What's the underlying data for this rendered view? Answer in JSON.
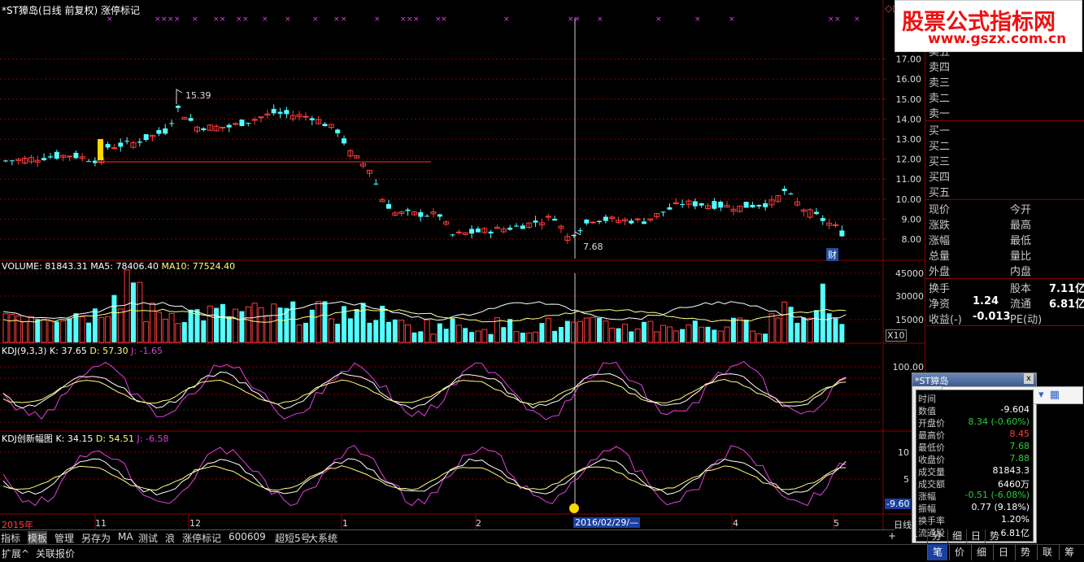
{
  "header": {
    "title": "*ST獐岛(日线 前复权) 涨停标记",
    "symbol": "◇◻"
  },
  "main_chart": {
    "price_axis": [
      "17.00",
      "16.00",
      "15.00",
      "14.00",
      "13.00",
      "12.00",
      "11.00",
      "10.00",
      "9.00",
      "8.00"
    ],
    "high_label": "15.39",
    "low_label": "7.68",
    "cai_badge": "财"
  },
  "volume_panel": {
    "title": "VOLUME: 81843.31",
    "ma5": "MA5: 78406.40",
    "ma10": "MA10: 77524.40",
    "axis": [
      "45000",
      "30000",
      "15000"
    ],
    "unit": "X10"
  },
  "kdj_panel": {
    "title": "KDJ(9,3,3)",
    "k": "K: 37.65",
    "d": "D: 57.30",
    "j": "J: -1.65",
    "axis": [
      "100.00",
      "80",
      "50",
      "20",
      "0"
    ]
  },
  "kdj2_panel": {
    "title": "KDJ创新幅图",
    "k": "K: 34.15",
    "d": "D: 54.51",
    "j": "J: -6.58",
    "axis": [
      "10",
      "5"
    ],
    "current": "-9.60"
  },
  "time_axis": {
    "labels": [
      {
        "text": "2015年"
      },
      {
        "text": "11"
      },
      {
        "text": "12"
      },
      {
        "text": "1"
      },
      {
        "text": "2"
      },
      {
        "text": "4"
      },
      {
        "text": "5"
      }
    ],
    "cursor_date": "2016/02/29/—",
    "cursor_suffix": "日线"
  },
  "quote_panel": {
    "sells": [
      "卖五",
      "卖四",
      "卖三",
      "卖二",
      "卖一"
    ],
    "buys": [
      "买一",
      "买二",
      "买三",
      "买四",
      "买五"
    ],
    "rows": [
      {
        "l": "现价",
        "r": "今开"
      },
      {
        "l": "涨跌",
        "r": "最高"
      },
      {
        "l": "涨幅",
        "r": "最低"
      },
      {
        "l": "总量",
        "r": "量比"
      },
      {
        "l": "外盘",
        "r": "内盘"
      }
    ],
    "huanshou": "换手",
    "guben": "股本",
    "guben_val": "7.11亿",
    "jingzi": "净资",
    "jingzi_val": "1.24",
    "liutong": "流通",
    "liutong_val": "6.81亿",
    "shouyi": "收益(-)",
    "shouyi_val": "-0.013",
    "pe": "PE(动)"
  },
  "watermark": {
    "line1": "股票公式指标网",
    "line2": "www.gszx.com.cn"
  },
  "popup": {
    "title": "*ST獐岛",
    "close": "x",
    "rows": [
      {
        "l": "时间",
        "v": "",
        "c": "#fff"
      },
      {
        "l": "数值",
        "v": "-9.604",
        "c": "#fff"
      },
      {
        "l": "开盘价",
        "v": "8.34 (-0.60%)",
        "c": "#2ecc40"
      },
      {
        "l": "最高价",
        "v": "8.45",
        "c": "#ff4040"
      },
      {
        "l": "最低价",
        "v": "7.68",
        "c": "#2ecc40"
      },
      {
        "l": "收盘价",
        "v": "7.88",
        "c": "#2ecc40"
      },
      {
        "l": "成交量",
        "v": "81843.3",
        "c": "#fff"
      },
      {
        "l": "成交额",
        "v": "6460万",
        "c": "#fff"
      },
      {
        "l": "涨幅",
        "v": "-0.51 (-6.08%)",
        "c": "#2ecc40"
      },
      {
        "l": "振幅",
        "v": "0.77 (9.18%)",
        "c": "#fff"
      },
      {
        "l": "换手率",
        "v": "1.20%",
        "c": "#fff"
      },
      {
        "l": "流通股",
        "v": "6.81亿",
        "c": "#fff"
      }
    ]
  },
  "toolbar": {
    "items": [
      "指标",
      "模板",
      "管理",
      "另存为",
      "MA",
      "测试",
      "浪",
      "涨停标记",
      "600609",
      "超短5号",
      "大系统"
    ]
  },
  "status": {
    "left": [
      "扩展^",
      "关联报价"
    ],
    "right_tabs": [
      "笔",
      "价",
      "细",
      "日",
      "势",
      "联",
      "筹"
    ],
    "mini_tabs": [
      "分",
      "细",
      "日",
      "势"
    ]
  },
  "colors": {
    "up": "#ff3c3c",
    "down": "#54ffff",
    "grid": "#8b0000",
    "k": "#ffffff",
    "d": "#ffff80",
    "j": "#e040e0"
  }
}
